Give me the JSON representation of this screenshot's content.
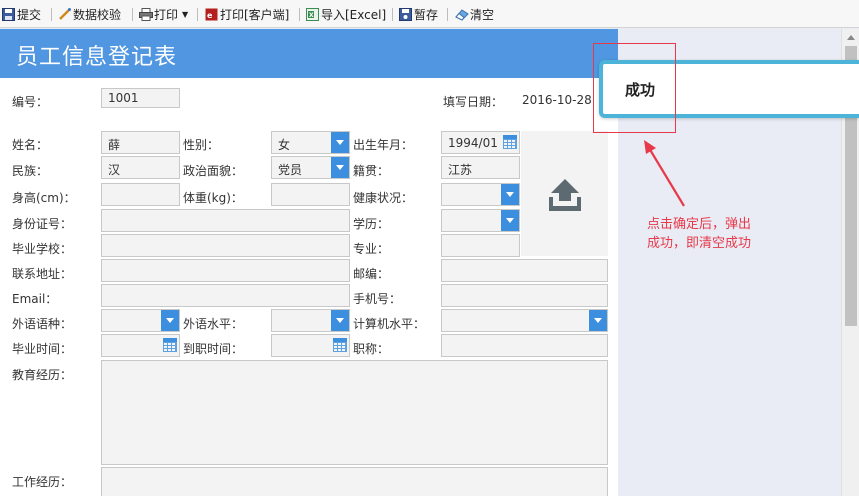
{
  "toolbar": {
    "submit": "提交",
    "validate": "数据校验",
    "print": "打印",
    "print_client": "打印[客户端]",
    "import_excel": "导入[Excel]",
    "save_draft": "暂存",
    "clear": "清空"
  },
  "form": {
    "title": "员工信息登记表",
    "number_label": "编号：",
    "number_value": "1001",
    "fill_date_label": "填写日期：",
    "fill_date_value": "2016-10-28",
    "fields": {
      "name_label": "姓名：",
      "name_value": "薛",
      "gender_label": "性别：",
      "gender_value": "女",
      "birth_label": "出生年月：",
      "birth_value": "1994/01",
      "ethnicity_label": "民族：",
      "ethnicity_value": "汉",
      "political_label": "政治面貌：",
      "political_value": "党员",
      "native_label": "籍贯：",
      "native_value": "江苏",
      "height_label": "身高(cm)：",
      "weight_label": "体重(kg)：",
      "health_label": "健康状况：",
      "idcard_label": "身份证号：",
      "education_label": "学历：",
      "school_label": "毕业学校：",
      "major_label": "专业：",
      "address_label": "联系地址：",
      "zip_label": "邮编：",
      "email_label": "Email：",
      "mobile_label": "手机号：",
      "lang_label": "外语语种：",
      "lang_level_label": "外语水平：",
      "computer_level_label": "计算机水平：",
      "grad_time_label": "毕业时间：",
      "join_time_label": "到职时间：",
      "title_label": "职称：",
      "edu_history_label": "教育经历：",
      "work_history_label": "工作经历："
    }
  },
  "toast": {
    "message": "成功"
  },
  "annotation": "点击确定后，弹出\n成功，即清空成功",
  "colors": {
    "banner": "#5096e0",
    "accent": "#3b8fde",
    "annotation": "#e8394a",
    "toast_border": "#4cb4d8"
  }
}
